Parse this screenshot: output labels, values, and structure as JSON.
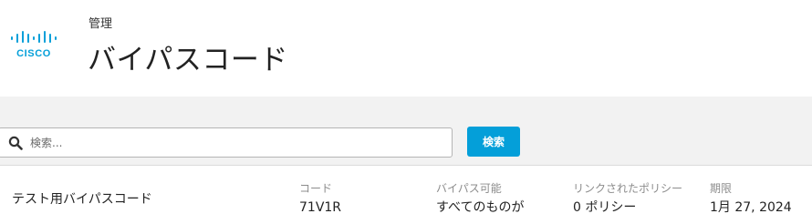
{
  "header": {
    "brand": "CISCO",
    "breadcrumb": "管理",
    "title": "バイパスコード"
  },
  "search": {
    "placeholder": "検索...",
    "value": "",
    "button_label": "検索"
  },
  "rows": [
    {
      "name": "テスト用バイパスコード",
      "code_label": "コード",
      "code": "71V1R",
      "bypass_label": "バイパス可能",
      "bypass": "すべてのものが",
      "policy_label": "リンクされたポリシー",
      "policy": "0 ポリシー",
      "expiry_label": "期限",
      "expiry": "1月 27, 2024"
    }
  ],
  "colors": {
    "brand_blue": "#049fd9",
    "band_bg": "#f2f2f2"
  },
  "icons": {
    "logo": "cisco-logo-icon",
    "search": "search-icon"
  }
}
